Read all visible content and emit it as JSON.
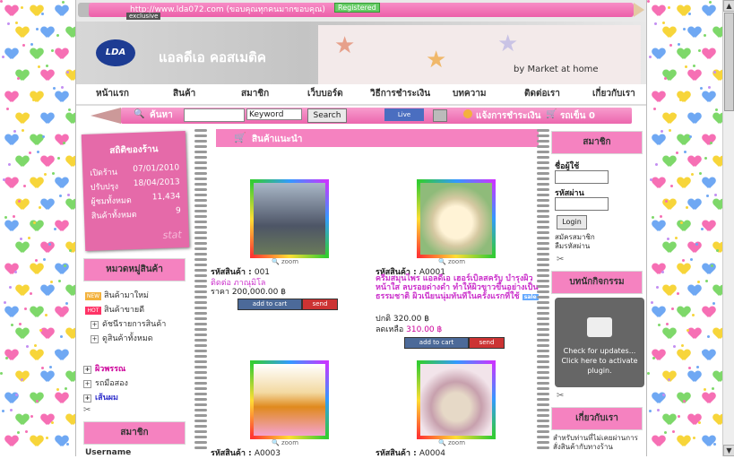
{
  "header": {
    "url_text": "http://www.lda072.com (ขอบคุณทุกคนมากขอบคุณ)",
    "registered": "Registered",
    "exclusive": "exclusive",
    "logo": "LDA",
    "site_name": "แอลดีเอ คอสเมติค",
    "decor_text": "by Market at home"
  },
  "nav": [
    "หน้าแรก",
    "สินค้า",
    "สมาชิก",
    "เว็บบอร์ด",
    "วิธีการชำระเงิน",
    "บทความ",
    "ติดต่อเรา",
    "เกี่ยวกับเรา"
  ],
  "search": {
    "label": "ค้นหา",
    "select_value": "Keyword",
    "button": "Search",
    "live_support": "Live Support",
    "payment": "แจ้งการชำระเงิน",
    "cart": "รถเข็น 0"
  },
  "stats": {
    "title": "สถิติของร้าน",
    "rows": [
      {
        "label": "เปิดร้าน",
        "value": "07/01/2010"
      },
      {
        "label": "ปรับปรุง",
        "value": "18/04/2013"
      },
      {
        "label": "ผู้ชมทั้งหมด",
        "value": "11,434"
      },
      {
        "label": "สินค้าทั้งหมด",
        "value": "9"
      }
    ],
    "stamp": "stat"
  },
  "categories": {
    "title": "หมวดหมู่สินค้า",
    "new_tag": "NEW",
    "hot_tag": "HOT",
    "items": [
      "สินค้ามาใหม่",
      "สินค้าขายดี",
      "ดัชนีรายการสินค้า",
      "ดูสินค้าทั้งหมด"
    ],
    "groups": [
      "ผิวพรรณ",
      "รถมือสอง",
      "เส้นผม"
    ]
  },
  "members_left": {
    "title": "สมาชิก",
    "username": "Username"
  },
  "products": {
    "title": "สินค้าแนะนำ",
    "code_label": "รหัสสินค้า : ",
    "zoom": "zoom",
    "cart_label": "add to cart",
    "send_label": "send",
    "items": [
      {
        "code": "001",
        "name": "ติดต่อ ภาณุมิโล",
        "price": "ราคา 200,000.00 ฿"
      },
      {
        "code": "A0001",
        "name": "ครีมสมุนไพร แอลดีเอ เฮอร์เบิลสครับ บำรุงผิวหน้าใส ลบรอยด่างดำ ทำให้ผิวขาวขึ้นอย่างเป็นธรรมชาติ ผิวเนียนนุ่มทันทีในครั้งแรกที่ใช้",
        "price_old": "ปกติ 320.00 ฿",
        "price_sale_label": "ลดเหลือ ",
        "price_sale": "310.00 ฿",
        "badge": "sale"
      },
      {
        "code": "A0003",
        "name": "",
        "price": ""
      },
      {
        "code": "A0004",
        "name": "",
        "price": ""
      }
    ]
  },
  "right": {
    "member_title": "สมาชิก",
    "user_label": "ชื่อผู้ใช้",
    "pass_label": "รหัสผ่าน",
    "login": "Login",
    "register": "สมัครสมาชิก",
    "forgot": "ลืมรหัสผ่าน",
    "calendar_title": "บทนักกิจกรรม",
    "plugin_text": "Check for updates... Click here to activate plugin.",
    "about_title": "เกี่ยวกับเรา",
    "about_text": "สำหรับท่านที่ไม่เคยผ่านการสั่งสินค้ากับทางร้าน"
  }
}
